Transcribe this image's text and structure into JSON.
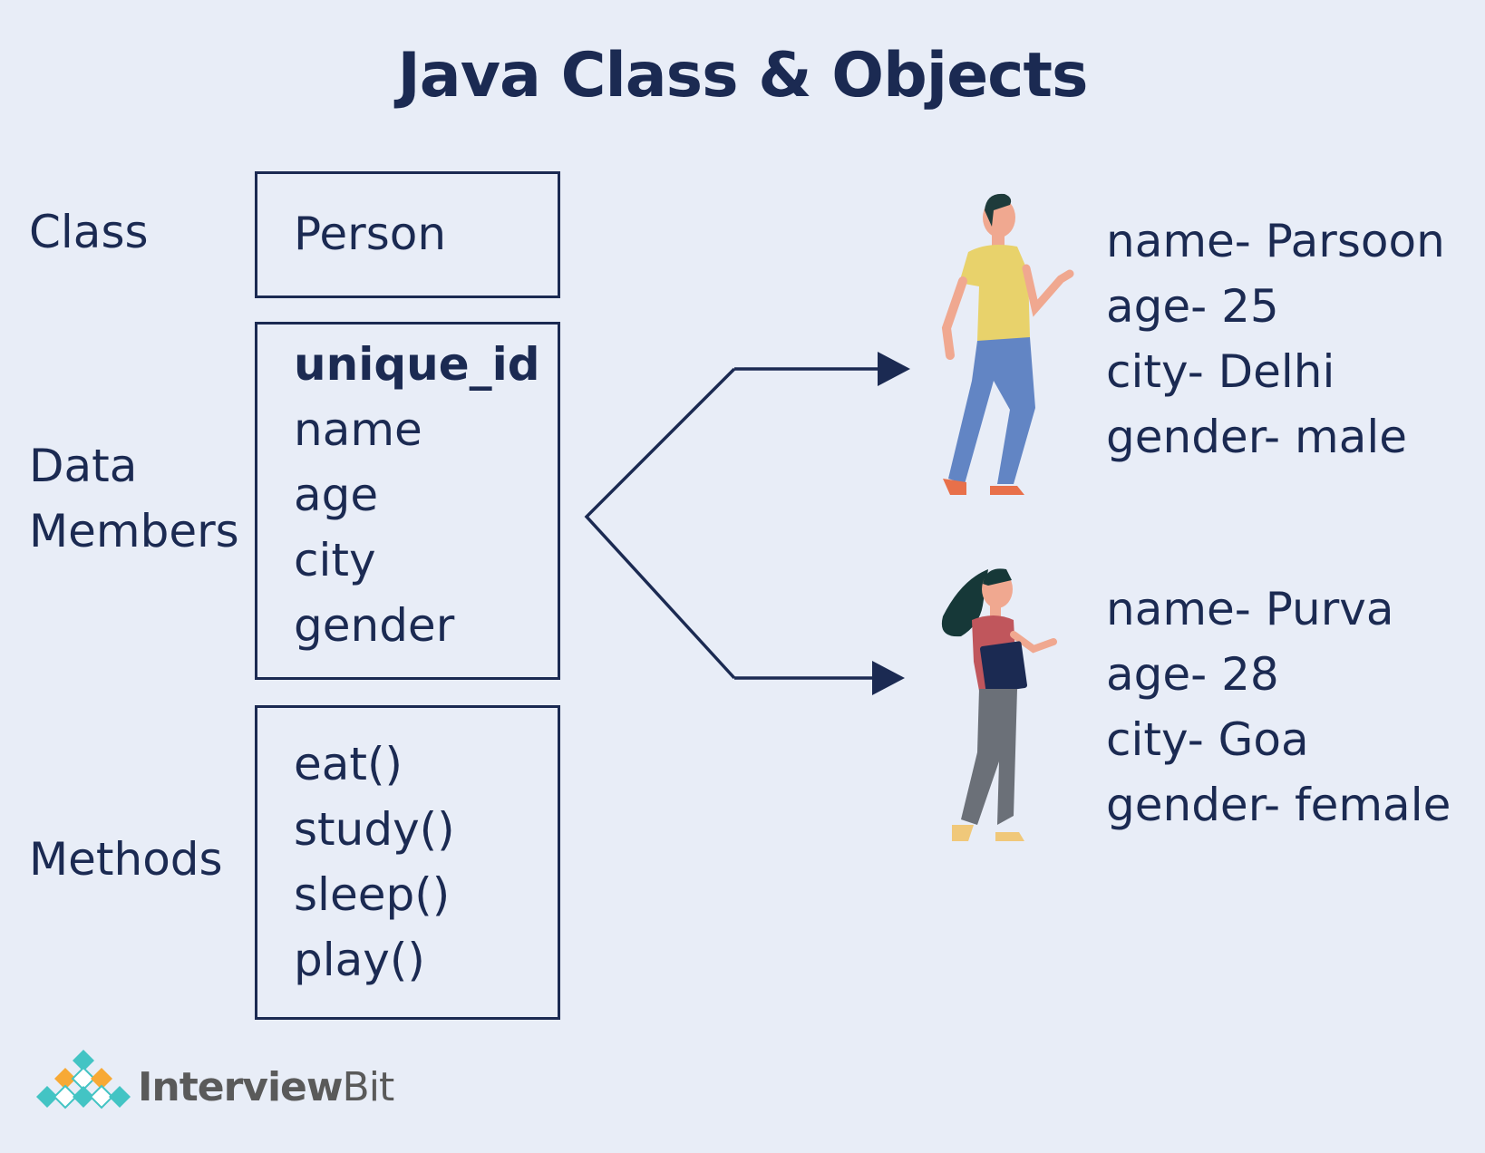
{
  "title": "Java Class & Objects",
  "labels": {
    "class": "Class",
    "data_members": [
      "Data",
      "Members"
    ],
    "methods": "Methods"
  },
  "class_box": {
    "name": "Person"
  },
  "members_box": {
    "items": [
      "unique_id",
      "name",
      "age",
      "city",
      "gender"
    ]
  },
  "methods_box": {
    "items": [
      "eat()",
      "study()",
      "sleep()",
      "play()"
    ]
  },
  "objects": [
    {
      "lines": [
        "name- Parsoon",
        "age- 25",
        "city- Delhi",
        "gender- male"
      ],
      "figure": "man-figure"
    },
    {
      "lines": [
        "name- Purva",
        "age- 28",
        "city- Goa",
        "gender- female"
      ],
      "figure": "woman-figure"
    }
  ],
  "logo": {
    "text_part1": "Interview",
    "text_part2": "Bit"
  },
  "colors": {
    "background": "#e8edf7",
    "ink": "#1b2a52",
    "shirt_man": "#e8d26b",
    "pants_man": "#6285c4",
    "shirt_woman": "#c0565c",
    "pants_woman": "#6b7078",
    "logo_orange": "#f7a935",
    "logo_teal": "#43c4c4"
  }
}
